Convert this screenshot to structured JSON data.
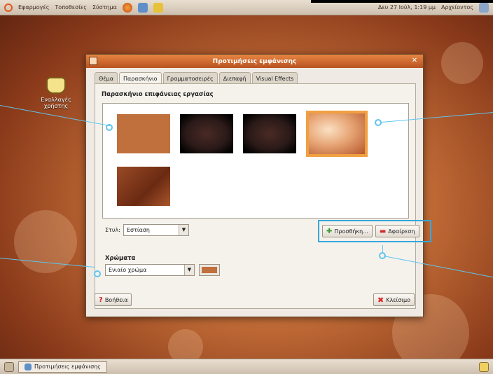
{
  "top_panel": {
    "menu_applications": "Εφαρμογές",
    "menu_places": "Τοποθεσίες",
    "menu_system": "Σύστημα",
    "clock": "Δευ 27 Ιούλ, 1:19 μμ",
    "user": "Αρχείοντος"
  },
  "desktop_icon": {
    "label": "Εναλλαγές χρήστης"
  },
  "dialog": {
    "title": "Προτιμήσεις εμφάνισης",
    "close_symbol": "✕",
    "tabs": [
      "Θέμα",
      "Παρασκήνιο",
      "Γραμματοσειρές",
      "Διεπαφή",
      "Visual Effects"
    ],
    "active_tab": "Παρασκήνιο",
    "section_title": "Παρασκήνιο επιφάνειας εργασίας",
    "style_label": "Στυλ:",
    "style_value": "Εστίαση",
    "add_button": "Προσθήκη...",
    "remove_button": "Αφαίρεση",
    "colors_title": "Χρώματα",
    "color_mode_value": "Ενιαίο χρώμα",
    "color_swatch": "#c0703c",
    "help_button": "Βοήθεια",
    "close_button": "Κλείσιμο"
  },
  "taskbar": {
    "window_button": "Προτιμήσεις εμφάνισης"
  },
  "colors": {
    "accent": "#e2581f",
    "callout": "#5fc5ee",
    "selection_border": "#f0a040"
  }
}
